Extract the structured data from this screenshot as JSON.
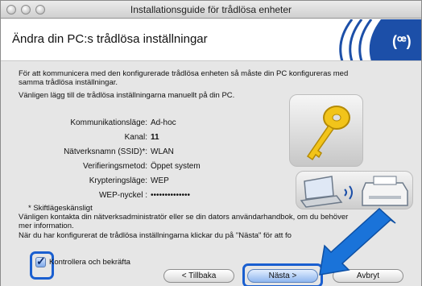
{
  "window": {
    "title": "Installationsguide för trådlösa enheter"
  },
  "header": {
    "title": "Ändra din PC:s trådlösa inställningar"
  },
  "body": {
    "intro_line1": "För att kommunicera med den konfigurerade trådlösa enheten så måste din PC konfigureras med",
    "intro_line2": "samma trådlösa inställningar.",
    "intro_line3": "Vänligen lägg till de trådlösa inställningarna manuellt på din PC."
  },
  "settings": [
    {
      "label": "Kommunikationsläge:",
      "value": "Ad-hoc",
      "bold": false
    },
    {
      "label": "Kanal:",
      "value": "11",
      "bold": true
    },
    {
      "label": "Nätverksnamn (SSID)*:",
      "value": "WLAN",
      "bold": false
    },
    {
      "label": "Verifieringsmetod:",
      "value": "Öppet system",
      "bold": false
    },
    {
      "label": "Krypteringsläge:",
      "value": "WEP",
      "bold": false
    },
    {
      "label": "WEP-nyckel :",
      "value": "••••••••••••••",
      "bold": false
    }
  ],
  "notes": {
    "case_sensitive": "* Skiftlägeskänsligt",
    "contact_line1": "Vänligen kontakta din nätverksadministratör eller se din dators användarhandbok, om du behöver",
    "contact_line2": "mer information.",
    "next_instruction": "När du har konfigurerat de trådlösa inställningarna klickar du på \"Nästa\" för att fo"
  },
  "confirm": {
    "label": "Kontrollera och bekräfta",
    "checked": true
  },
  "buttons": {
    "back": "< Tillbaka",
    "next": "Nästa >",
    "cancel": "Avbryt"
  },
  "colors": {
    "highlight": "#1a5fd0",
    "logo_blue": "#1c4fa8"
  },
  "icons": {
    "logo": "wireless-signal-logo",
    "key": "key-icon",
    "devices": "laptop-printer-icon",
    "pointer": "blue-arrow"
  }
}
